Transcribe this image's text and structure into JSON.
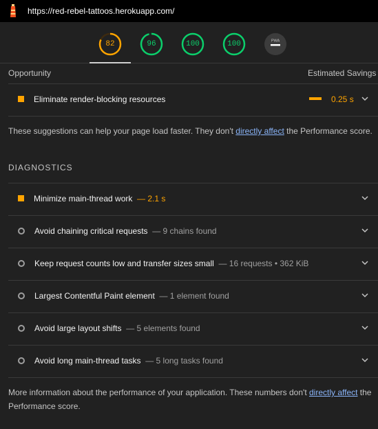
{
  "topbar": {
    "url": "https://red-rebel-tattoos.herokuapp.com/",
    "logo_icon": "lighthouse-icon"
  },
  "gauges": [
    {
      "value": "82",
      "score": 0.82,
      "color": "#ffa400"
    },
    {
      "value": "96",
      "score": 0.96,
      "color": "#0cce6b"
    },
    {
      "value": "100",
      "score": 1.0,
      "color": "#0cce6b"
    },
    {
      "value": "100",
      "score": 1.0,
      "color": "#0cce6b"
    },
    {
      "value": "PWA",
      "score": 0,
      "color": "#9e9e9e"
    }
  ],
  "opportunity": {
    "header_left": "Opportunity",
    "header_right": "Estimated Savings",
    "items": [
      {
        "title": "Eliminate render-blocking resources",
        "savings": "0.25 s",
        "savings_fraction": 0.08
      }
    ]
  },
  "opportunity_note": {
    "before": "These suggestions can help your page load faster. They don't ",
    "link": "directly affect",
    "after": " the Performance score."
  },
  "diagnostics": {
    "heading": "DIAGNOSTICS",
    "items": [
      {
        "title": "Minimize main-thread work",
        "detail": "— 2.1 s",
        "status": "warn"
      },
      {
        "title": "Avoid chaining critical requests",
        "detail": "— 9 chains found",
        "status": "info"
      },
      {
        "title": "Keep request counts low and transfer sizes small",
        "detail": "— 16 requests • 362 KiB",
        "status": "info"
      },
      {
        "title": "Largest Contentful Paint element",
        "detail": "— 1 element found",
        "status": "info"
      },
      {
        "title": "Avoid large layout shifts",
        "detail": "— 5 elements found",
        "status": "info"
      },
      {
        "title": "Avoid long main-thread tasks",
        "detail": "— 5 long tasks found",
        "status": "info"
      }
    ]
  },
  "diagnostics_note": {
    "before": "More information about the performance of your application. These numbers don't ",
    "link": "directly affect",
    "after": " the Performance score."
  },
  "colors": {
    "warn": "#ffa400",
    "pass": "#0cce6b",
    "neutral": "#9e9e9e",
    "link": "#8ab4f8"
  }
}
